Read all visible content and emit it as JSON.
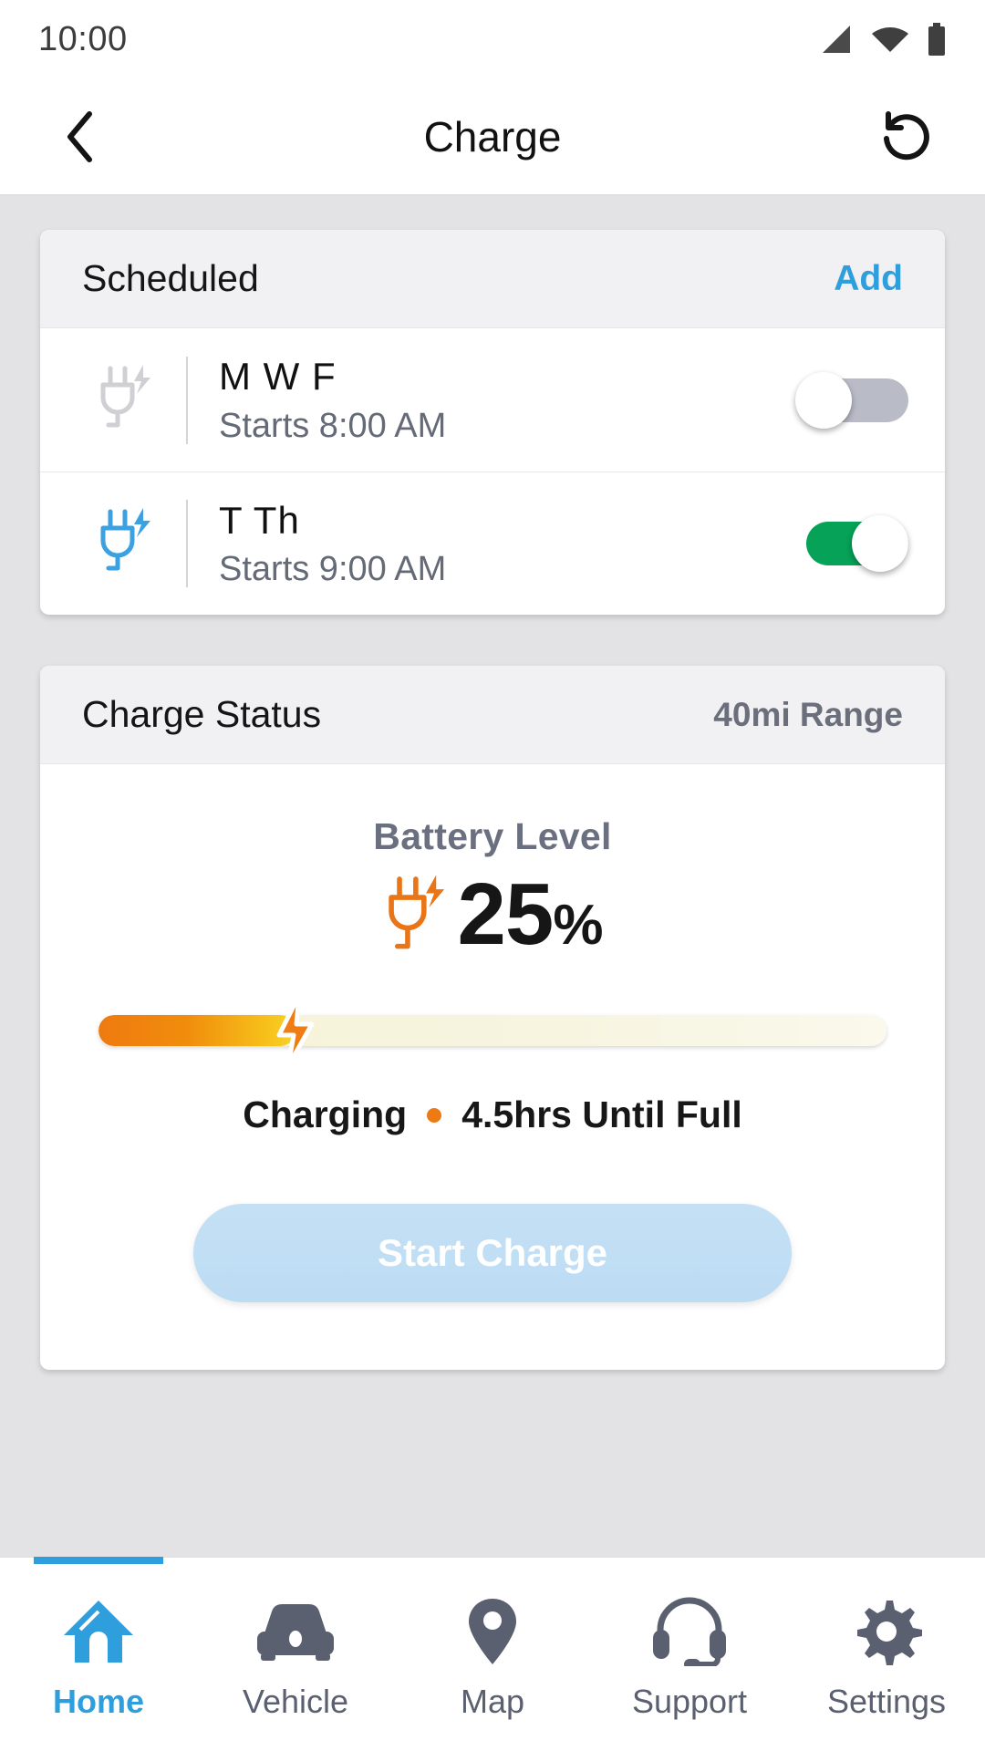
{
  "status_bar": {
    "time": "10:00",
    "icons": [
      "signal-icon",
      "wifi-icon",
      "battery-icon"
    ]
  },
  "app_bar": {
    "back_icon": "chevron-left-icon",
    "title": "Charge",
    "refresh_icon": "refresh-counterclockwise-icon"
  },
  "scheduled_card": {
    "title": "Scheduled",
    "action_label": "Add",
    "rows": [
      {
        "icon": "plug-charge-icon",
        "icon_state": "inactive",
        "days": "M W F",
        "start": "Starts 8:00 AM",
        "toggle_on": false
      },
      {
        "icon": "plug-charge-icon",
        "icon_state": "active",
        "days": "T Th",
        "start": "Starts 9:00 AM",
        "toggle_on": true
      }
    ]
  },
  "charge_status_card": {
    "title": "Charge Status",
    "range": "40mi Range",
    "battery_label": "Battery Level",
    "battery_icon": "plug-charge-icon",
    "battery_value": "25",
    "battery_unit": "%",
    "battery_percent": 25,
    "status_text": "Charging",
    "status_detail": "4.5hrs Until Full",
    "cta_label": "Start Charge"
  },
  "bottom_nav": {
    "items": [
      {
        "label": "Home",
        "icon": "home-icon",
        "active": true
      },
      {
        "label": "Vehicle",
        "icon": "car-icon",
        "active": false
      },
      {
        "label": "Map",
        "icon": "map-pin-icon",
        "active": false
      },
      {
        "label": "Support",
        "icon": "headset-icon",
        "active": false
      },
      {
        "label": "Settings",
        "icon": "gear-icon",
        "active": false
      }
    ]
  },
  "colors": {
    "accent_blue": "#2e9fdc",
    "toggle_on_green": "#05a257",
    "toggle_off_gray": "#b9bcc7",
    "charge_orange": "#ee7a16",
    "page_bg": "#e3e3e5",
    "card_header_bg": "#f1f0f3"
  }
}
